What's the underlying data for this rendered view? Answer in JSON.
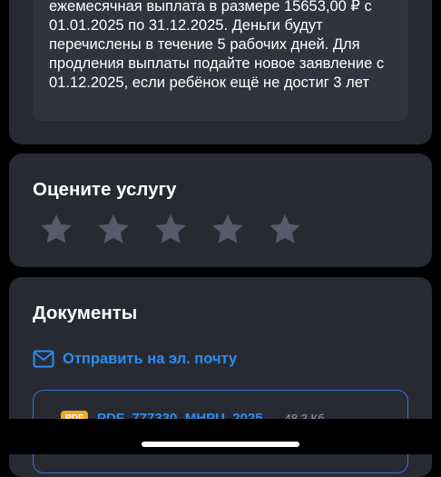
{
  "info": {
    "text": "ежемесячная выплата в размере 15653,00 ₽ с 01.01.2025 по 31.12.2025. Деньги будут перечислены в течение 5 рабочих дней. Для продления выплаты подайте новое заявление с 01.12.2025, если ребёнок ещё не достиг 3 лет"
  },
  "rating": {
    "title": "Оцените услугу",
    "stars_total": 5,
    "stars_selected": 0,
    "star_color": "#565b6b"
  },
  "documents": {
    "title": "Документы",
    "email_link": "Отправить на эл. почту",
    "file": {
      "badge": "PDF",
      "name": "PDF_777330_MHPU_2025",
      "size": "48,3 Кб"
    }
  },
  "colors": {
    "background": "#000000",
    "card": "#272a33",
    "info_box": "#31343e",
    "accent": "#2f8cf0"
  }
}
